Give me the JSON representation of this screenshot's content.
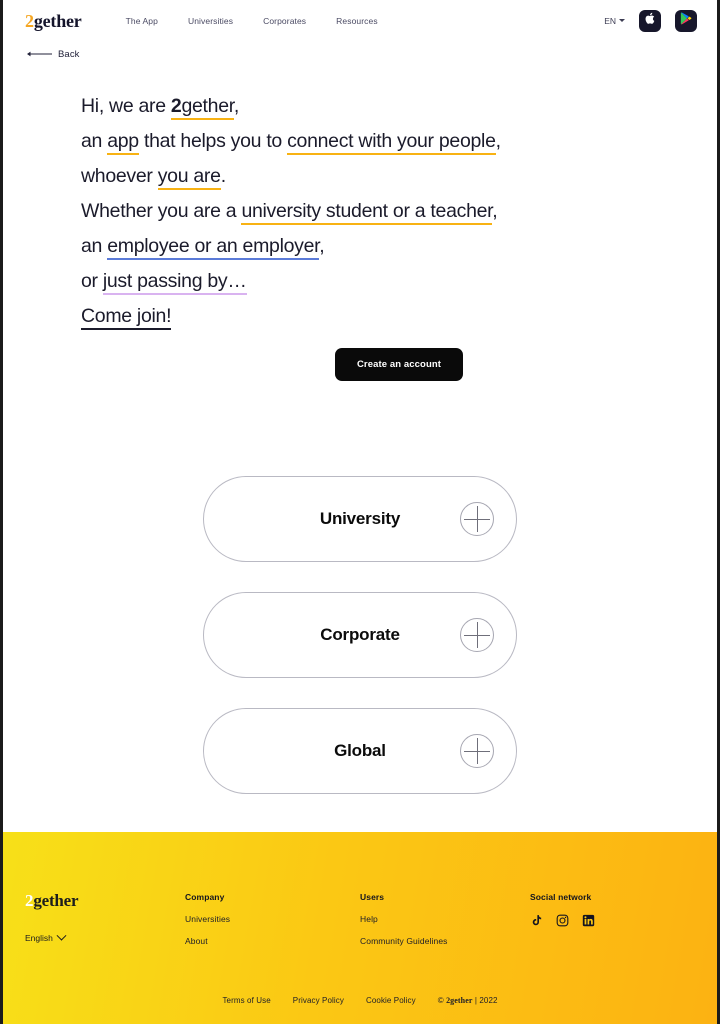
{
  "brand": {
    "digit": "2",
    "word": "gether",
    "full": "2gether"
  },
  "header": {
    "nav": [
      {
        "label": "The App"
      },
      {
        "label": "Universities"
      },
      {
        "label": "Corporates"
      },
      {
        "label": "Resources"
      }
    ],
    "language": "EN",
    "app_store_icon": "apple-icon",
    "play_store_icon": "google-play-icon"
  },
  "back": {
    "label": "Back",
    "icon": "arrow-left-icon"
  },
  "hero": {
    "lines": [
      {
        "segments": [
          {
            "text": "Hi, we are ",
            "style": "plain"
          },
          {
            "text": "2",
            "style": "amber-bold"
          },
          {
            "text": "gether",
            "style": "amber"
          },
          {
            "text": ",",
            "style": "plain"
          }
        ]
      },
      {
        "segments": [
          {
            "text": "an ",
            "style": "plain"
          },
          {
            "text": "app",
            "style": "amber"
          },
          {
            "text": " that helps you to ",
            "style": "plain"
          },
          {
            "text": "connect with your people",
            "style": "amber"
          },
          {
            "text": ",",
            "style": "plain"
          }
        ]
      },
      {
        "segments": [
          {
            "text": "whoever ",
            "style": "plain"
          },
          {
            "text": "you are",
            "style": "amber"
          },
          {
            "text": ".",
            "style": "plain"
          }
        ]
      },
      {
        "segments": [
          {
            "text": "Whether you are a ",
            "style": "plain"
          },
          {
            "text": "university student or a teacher",
            "style": "amber"
          },
          {
            "text": ",",
            "style": "plain"
          }
        ]
      },
      {
        "segments": [
          {
            "text": "an ",
            "style": "plain"
          },
          {
            "text": "employee or an employer",
            "style": "blue"
          },
          {
            "text": ",",
            "style": "plain"
          }
        ]
      },
      {
        "segments": [
          {
            "text": "or ",
            "style": "plain"
          },
          {
            "text": "just passing by…",
            "style": "violet"
          }
        ]
      },
      {
        "segments": [
          {
            "text": "Come join!",
            "style": "dark"
          }
        ]
      }
    ],
    "cta_label": "Create an account"
  },
  "cards": [
    {
      "label": "University",
      "action_icon": "plus-icon"
    },
    {
      "label": "Corporate",
      "action_icon": "plus-icon"
    },
    {
      "label": "Global",
      "action_icon": "plus-icon"
    }
  ],
  "footer": {
    "language": "English",
    "columns": [
      {
        "key": "company",
        "heading": "Company",
        "links": [
          "Universities",
          "About"
        ]
      },
      {
        "key": "users",
        "heading": "Users",
        "links": [
          "Help",
          "Community Guidelines"
        ]
      }
    ],
    "social": {
      "heading": "Social network",
      "icons": [
        "tiktok-icon",
        "instagram-icon",
        "linkedin-icon"
      ]
    },
    "legal": [
      "Terms of Use",
      "Privacy Policy",
      "Cookie Policy"
    ],
    "copyright_prefix": "© ",
    "copyright_suffix": " | 2022"
  },
  "colors": {
    "amber": "#F8B213",
    "blue": "#5B7BD8",
    "violet": "#D9B3F0",
    "dark": "#1b1b2b",
    "footer_left": "#F7E018",
    "footer_right": "#FCB212",
    "cta_bg": "#0a0a0a"
  }
}
